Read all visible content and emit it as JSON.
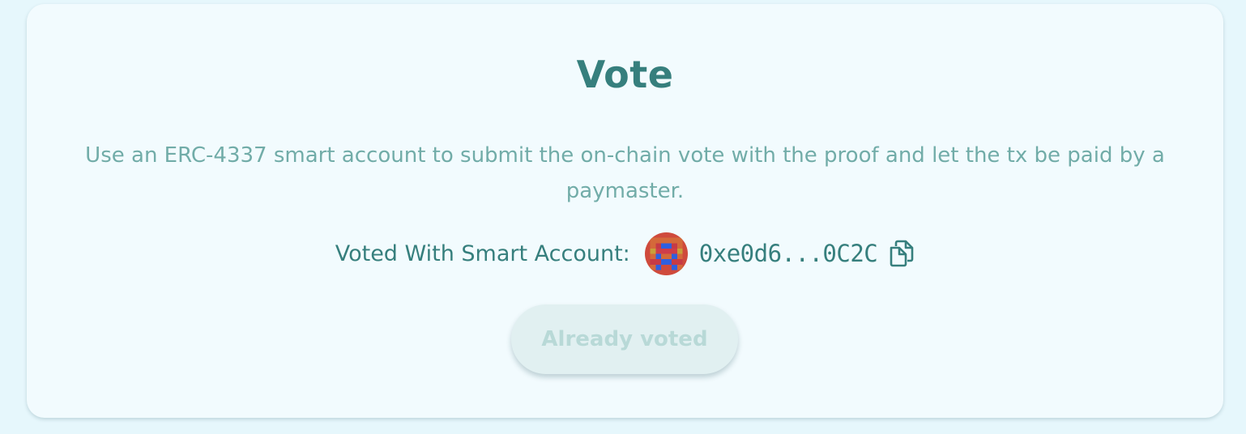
{
  "vote_card": {
    "title": "Vote",
    "description": "Use an ERC-4337 smart account to submit the on-chain vote with the proof and let the tx be paid by a paymaster.",
    "account_label": "Voted With Smart Account:",
    "account_address": "0xe0d6...0C2C",
    "avatar_icon": "identicon-avatar",
    "copy_icon": "copy-icon",
    "button_label": "Already voted",
    "button_disabled": true
  },
  "colors": {
    "page_background": "#e6f7fc",
    "card_background": "#f2fbfe",
    "primary_text": "#367f7d",
    "muted_text": "#71aca8",
    "disabled_button_bg": "#e1f0f1",
    "disabled_button_text": "#b8d9d7",
    "avatar_red": "#d0453a",
    "avatar_blue": "#2f5fe0"
  }
}
